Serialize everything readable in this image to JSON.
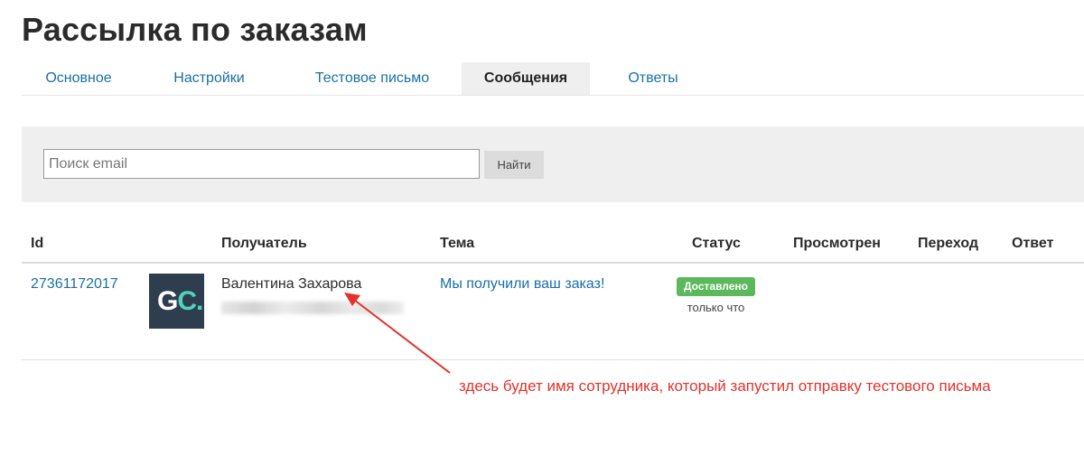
{
  "page": {
    "title": "Рассылка по заказам"
  },
  "tabs": [
    {
      "label": "Основное",
      "active": false
    },
    {
      "label": "Настройки",
      "active": false
    },
    {
      "label": "Тестовое письмо",
      "active": false
    },
    {
      "label": "Сообщения",
      "active": true
    },
    {
      "label": "Ответы",
      "active": false
    }
  ],
  "search": {
    "placeholder": "Поиск email",
    "value": "",
    "button_label": "Найти"
  },
  "table": {
    "columns": [
      "Id",
      "Получатель",
      "Тема",
      "Статус",
      "Просмотрен",
      "Переход",
      "Ответ"
    ],
    "rows": [
      {
        "id": "27361172017",
        "avatar": {
          "letter1": "G",
          "letter2": "C",
          "dot": "."
        },
        "recipient_name": "Валентина Захарова",
        "subject": "Мы получили ваш заказ!",
        "status": "Доставлено",
        "status_time": "только что",
        "viewed": "",
        "clicked": "",
        "replied": ""
      }
    ]
  },
  "annotation": {
    "text": "здесь будет имя сотрудника, который запустил отправку тестового письма",
    "color": "#e3322b"
  },
  "colors": {
    "link": "#1a6fa5",
    "status_delivered": "#5cb85c",
    "avatar_bg": "#2f3e4e",
    "avatar_accent": "#4fd2bf"
  }
}
